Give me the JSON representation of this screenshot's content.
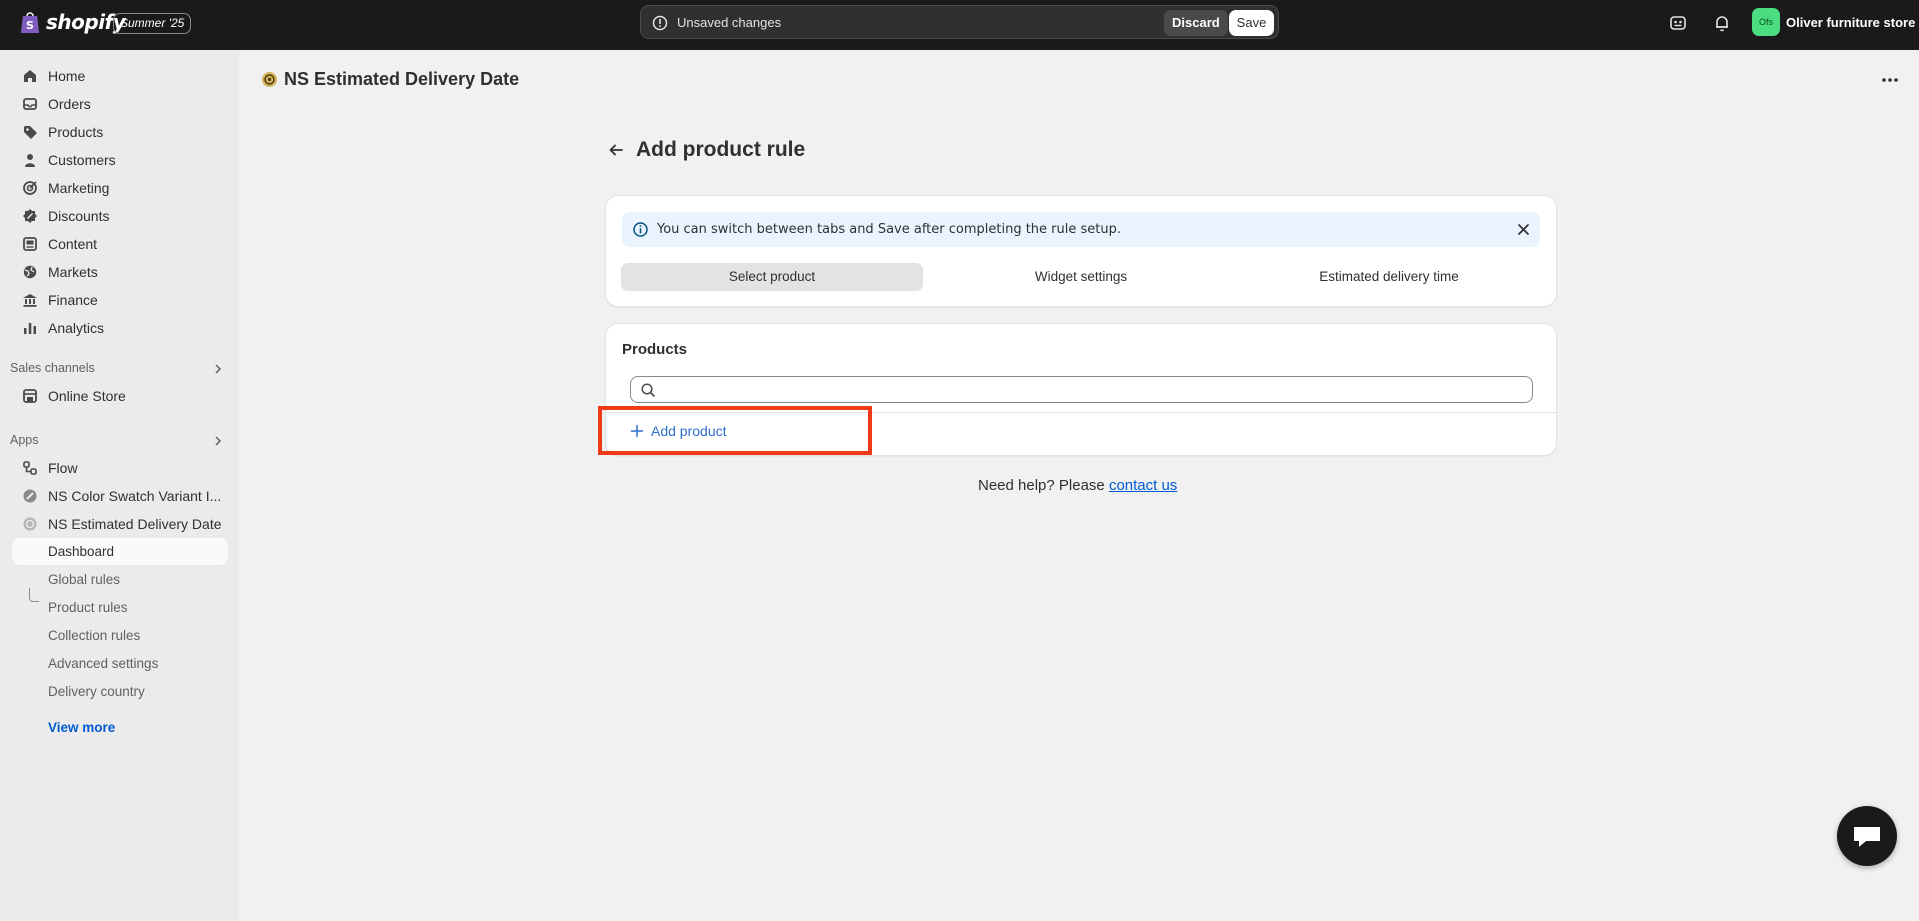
{
  "topbar": {
    "brand": "shopify",
    "edition_badge": "Summer '25",
    "unsaved_text": "Unsaved changes",
    "discard_label": "Discard",
    "save_label": "Save",
    "store_initials": "Ofs",
    "store_name": "Oliver furniture store"
  },
  "sidebar": {
    "main_items": [
      {
        "label": "Home",
        "icon": "home-icon"
      },
      {
        "label": "Orders",
        "icon": "orders-icon"
      },
      {
        "label": "Products",
        "icon": "tag-icon"
      },
      {
        "label": "Customers",
        "icon": "person-icon"
      },
      {
        "label": "Marketing",
        "icon": "target-icon"
      },
      {
        "label": "Discounts",
        "icon": "discount-icon"
      },
      {
        "label": "Content",
        "icon": "content-icon"
      },
      {
        "label": "Markets",
        "icon": "globe-icon"
      },
      {
        "label": "Finance",
        "icon": "bank-icon"
      },
      {
        "label": "Analytics",
        "icon": "bar-chart-icon"
      }
    ],
    "sales_channels_label": "Sales channels",
    "online_store_label": "Online Store",
    "apps_label": "Apps",
    "apps": [
      {
        "label": "Flow",
        "icon": "flow-icon"
      },
      {
        "label": "NS Color Swatch Variant I...",
        "icon": "swatch-app-icon"
      },
      {
        "label": "NS Estimated Delivery Date",
        "icon": "delivery-app-icon"
      }
    ],
    "sub_items": [
      {
        "label": "Dashboard",
        "active": true
      },
      {
        "label": "Global rules"
      },
      {
        "label": "Product rules"
      },
      {
        "label": "Collection rules"
      },
      {
        "label": "Advanced settings"
      },
      {
        "label": "Delivery country"
      }
    ],
    "view_more": "View more"
  },
  "main": {
    "app_title": "NS Estimated Delivery Date",
    "page_title": "Add product rule",
    "banner_text": "You can switch between tabs and Save after completing the rule setup.",
    "tabs": [
      {
        "label": "Select product",
        "selected": true
      },
      {
        "label": "Widget settings",
        "selected": false
      },
      {
        "label": "Estimated delivery time",
        "selected": false
      }
    ],
    "products_card": {
      "title": "Products",
      "search_placeholder": "",
      "add_product_label": "Add product"
    },
    "help_text": "Need help? Please",
    "help_link": "contact us"
  },
  "colors": {
    "topbar_bg": "#1a1a1a",
    "accent_link": "#005bd3",
    "highlight_border": "#f03a17",
    "banner_bg": "#eaf4ff"
  }
}
